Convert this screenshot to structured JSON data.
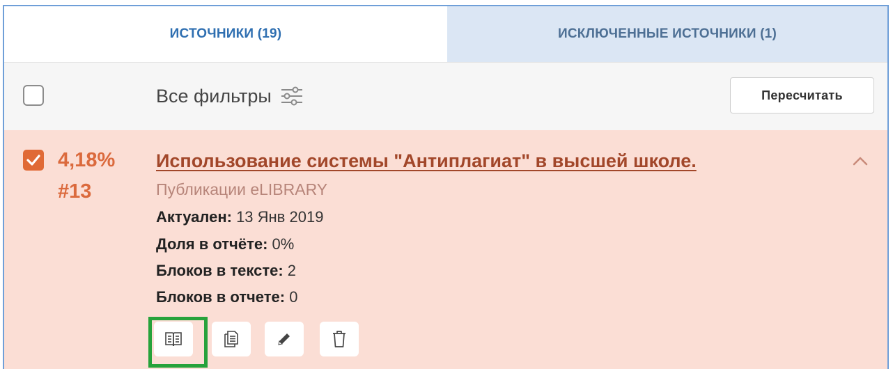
{
  "tabs": {
    "sources": "Источники (19)",
    "excluded": "Исключенные источники (1)"
  },
  "filters": {
    "label": "Все фильтры",
    "recalculate": "Пересчитать"
  },
  "source": {
    "selected": true,
    "percent": "4,18%",
    "rank": "#13",
    "title": "Использование системы \"Антиплагиат\" в высшей школе.",
    "collection": "Публикации eLIBRARY",
    "fields": [
      {
        "label": "Актуален:",
        "value": "13 Янв 2019"
      },
      {
        "label": "Доля в отчёте:",
        "value": "0%"
      },
      {
        "label": "Блоков в тексте:",
        "value": "2"
      },
      {
        "label": "Блоков в отчете:",
        "value": "0"
      }
    ],
    "actions": [
      "open-book-icon",
      "copy-document-icon",
      "pencil-icon",
      "trash-icon"
    ]
  },
  "colors": {
    "tab_active_text": "#2f6fb1",
    "tab_inactive_bg": "#dbe6f4",
    "card_bg": "#fbded5",
    "accent": "#e06a36",
    "title": "#a2472a",
    "highlight": "#27a23b"
  }
}
